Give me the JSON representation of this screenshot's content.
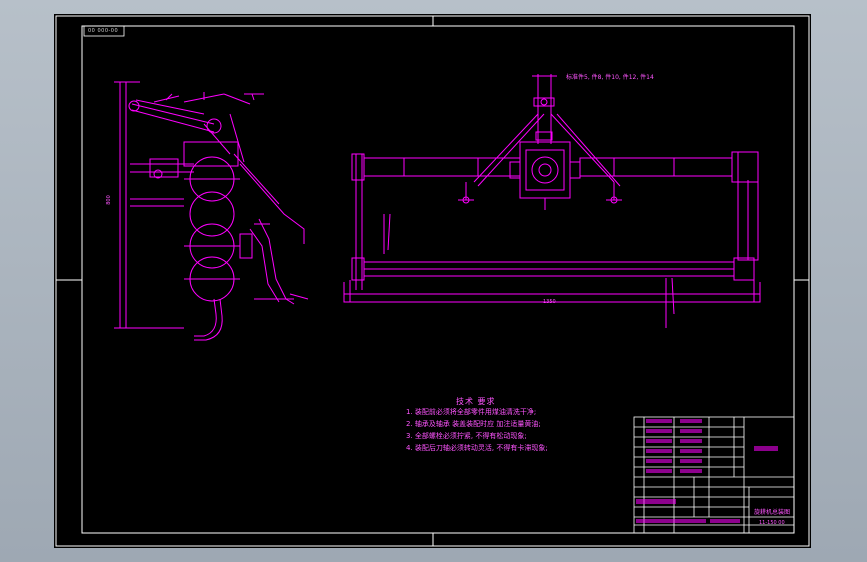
{
  "drawing": {
    "code_top": "00 000-00",
    "note_top": "标准件5, 件8, 件10, 件12, 件14",
    "dim_bottom": "1350",
    "dim_side": "800",
    "title_name": "旋耕机总装图",
    "title_code": "11-150 00"
  },
  "technical_requirements": {
    "title": "技术 要求",
    "items": [
      "1. 装配前必须将全部零件用煤油清洗干净;",
      "2. 轴承及轴承 装盖装配时应 加注适量黄油;",
      "3. 全部螺栓必须拧紧, 不得有松动现象;",
      "4. 装配后刀轴必须转动灵活, 不得有卡滞现象;"
    ]
  },
  "colors": {
    "line": "#ff00ff",
    "frame": "#ffffff",
    "background": "#000000"
  }
}
